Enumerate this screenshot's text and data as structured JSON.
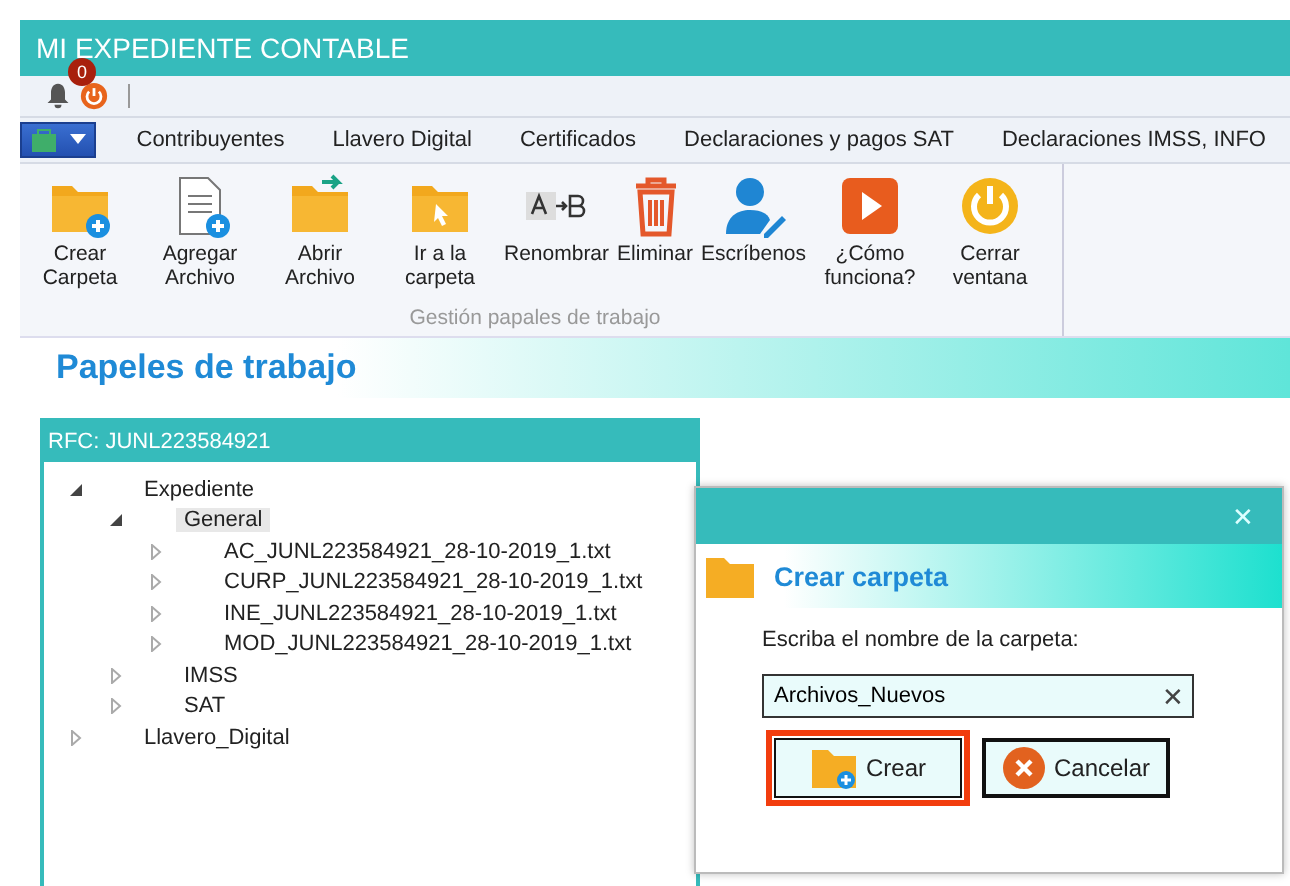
{
  "window": {
    "title": "MI EXPEDIENTE CONTABLE"
  },
  "notifications": {
    "count": "0"
  },
  "tabs": [
    {
      "label": "Contribuyentes",
      "selected": false
    },
    {
      "label": "Llavero Digital",
      "selected": false
    },
    {
      "label": "Certificados",
      "selected": false
    },
    {
      "label": "Declaraciones y pagos SAT",
      "selected": false
    },
    {
      "label": "Declaraciones IMSS, INFO",
      "selected": false
    }
  ],
  "ribbon": {
    "group_label": "Gestión papales de trabajo",
    "buttons": [
      {
        "kind": "new-folder",
        "label": "Crear Carpeta"
      },
      {
        "kind": "add-file",
        "label": "Agregar Archivo"
      },
      {
        "kind": "open-folder",
        "label": "Abrir Archivo"
      },
      {
        "kind": "goto-folder",
        "label": "Ir a la carpeta"
      },
      {
        "kind": "rename",
        "label": "Renombrar"
      },
      {
        "kind": "delete",
        "label": "Eliminar"
      },
      {
        "kind": "write",
        "label": "Escríbenos"
      },
      {
        "kind": "play",
        "label": "¿Cómo funciona?"
      },
      {
        "kind": "power",
        "label": "Cerrar ventana"
      }
    ]
  },
  "page_title": "Papeles de trabajo",
  "tree": {
    "title": "RFC: JUNL223584921",
    "nodes": [
      {
        "label": "Expediente",
        "expanded": true,
        "selected": false,
        "children": [
          {
            "label": "General",
            "expanded": true,
            "selected": true,
            "children": [
              {
                "label": "AC_JUNL223584921_28-10-2019_1.txt",
                "expanded": false,
                "selected": false
              },
              {
                "label": "CURP_JUNL223584921_28-10-2019_1.txt",
                "expanded": false,
                "selected": false
              },
              {
                "label": "INE_JUNL223584921_28-10-2019_1.txt",
                "expanded": false,
                "selected": false
              },
              {
                "label": "MOD_JUNL223584921_28-10-2019_1.txt",
                "expanded": false,
                "selected": false
              }
            ]
          },
          {
            "label": "IMSS",
            "expanded": false,
            "selected": false
          },
          {
            "label": "SAT",
            "expanded": false,
            "selected": false
          }
        ]
      },
      {
        "label": "Llavero_Digital",
        "expanded": false,
        "selected": false
      }
    ]
  },
  "dialog": {
    "close": "✕",
    "title": "Crear carpeta",
    "prompt": "Escriba el nombre de la carpeta:",
    "field_value": "Archivos_Nuevos",
    "clear": "✕",
    "buttons": [
      {
        "kind": "create",
        "label": "Crear",
        "selected": true
      },
      {
        "kind": "cancel",
        "label": "Cancelar",
        "selected": false
      }
    ]
  }
}
